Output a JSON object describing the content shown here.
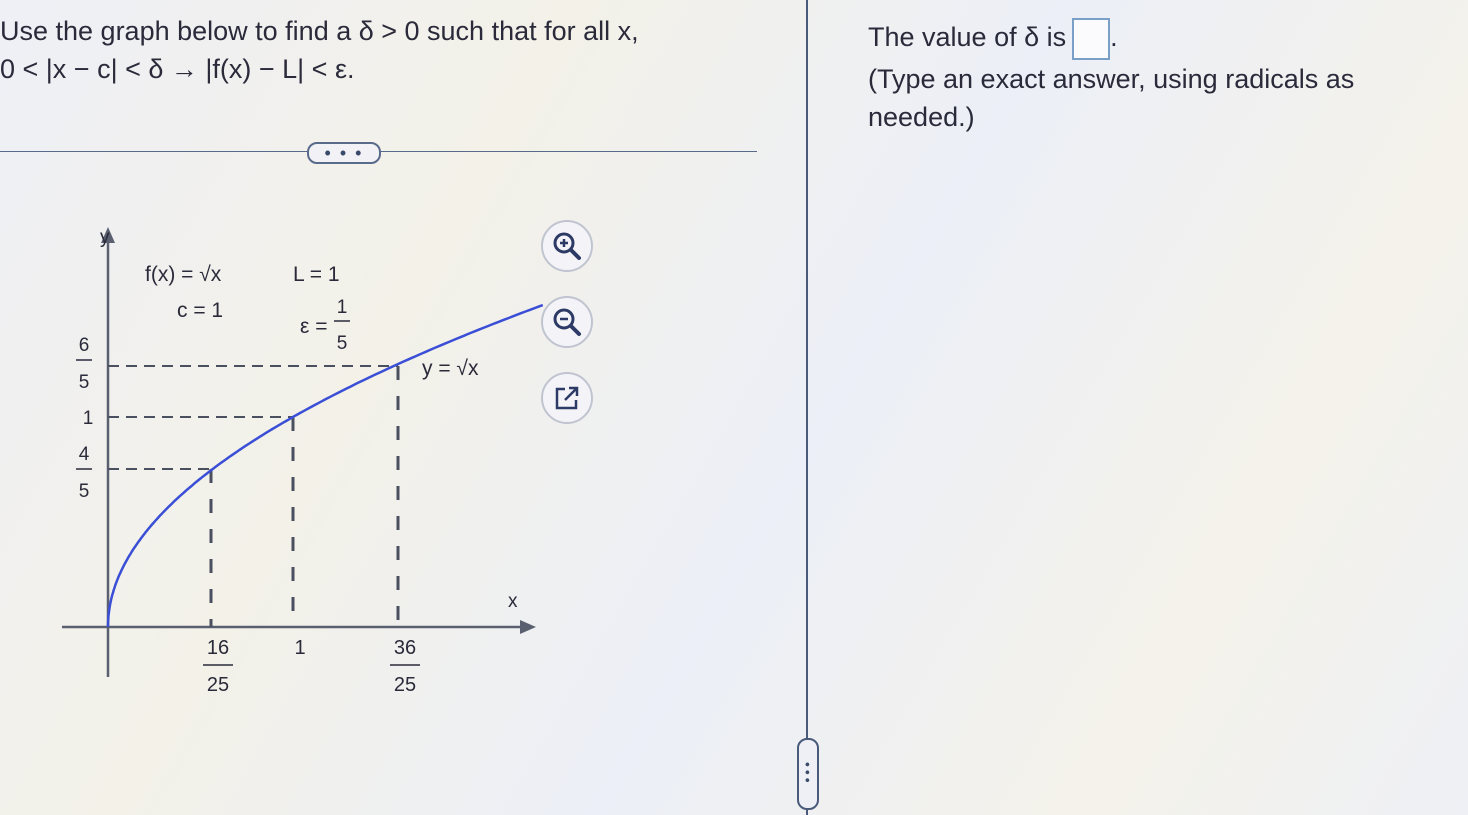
{
  "question": {
    "line1": "Use the graph below to find a δ > 0 such that for all x,",
    "line2": "0 < |x − c| < δ → |f(x) − L| < ε."
  },
  "more_button": "• • •",
  "answer": {
    "prefix": "The value of δ is",
    "suffix": ".",
    "hint": "(Type an exact answer, using radicals as needed.)"
  },
  "graph": {
    "y_axis_label": "y",
    "x_axis_label": "x",
    "function_label": "f(x) = √x",
    "c_label": "c = 1",
    "L_label": "L = 1",
    "epsilon_label": "ε =",
    "epsilon_num": "1",
    "epsilon_den": "5",
    "curve_label": "y = √x",
    "y_ticks": [
      {
        "num": "6",
        "den": "5"
      },
      {
        "whole": "1"
      },
      {
        "num": "4",
        "den": "5"
      }
    ],
    "x_ticks": [
      {
        "num": "16",
        "den": "25"
      },
      {
        "whole": "1"
      },
      {
        "num": "36",
        "den": "25"
      }
    ],
    "curve_color": "#3a4fd6"
  },
  "tools": [
    "zoom-in-icon",
    "zoom-out-icon",
    "popout-icon"
  ]
}
